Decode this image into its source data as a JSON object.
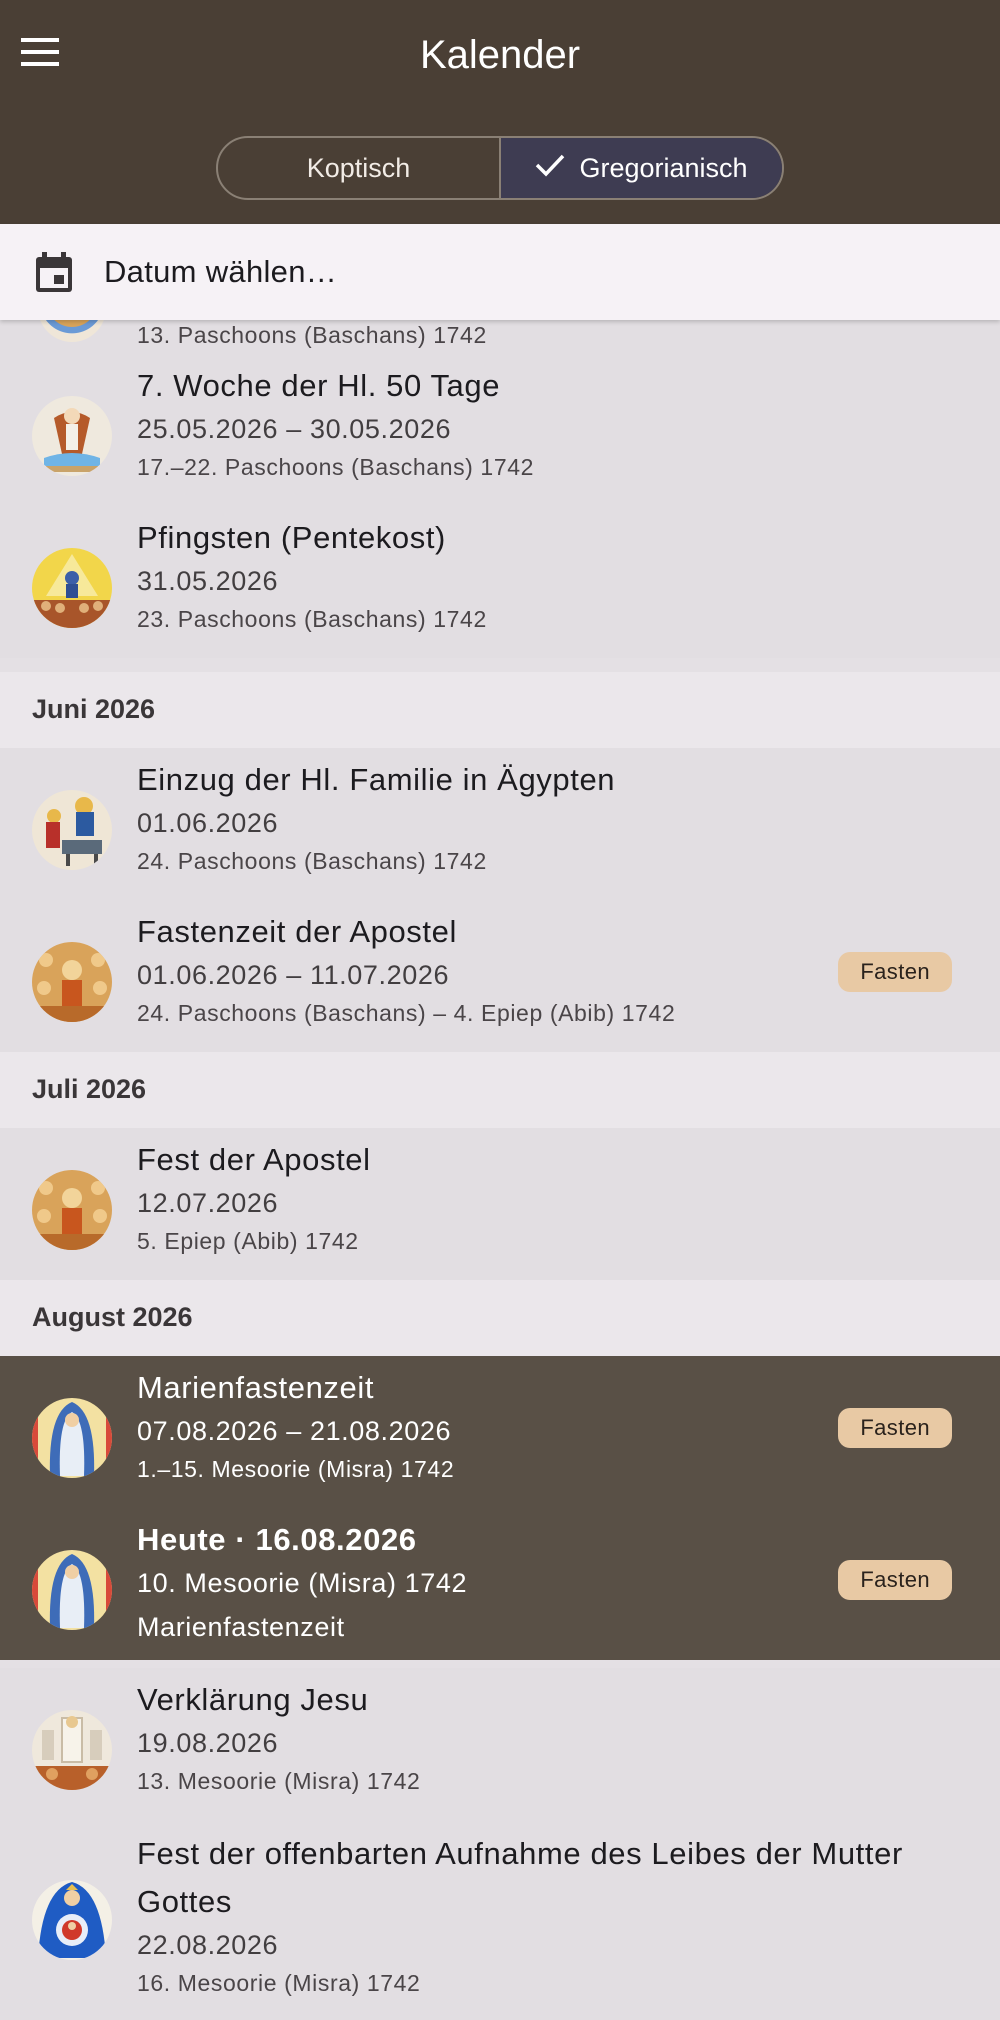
{
  "appbar": {
    "title": "Kalender",
    "segments": [
      {
        "label": "Koptisch",
        "selected": false
      },
      {
        "label": "Gregorianisch",
        "selected": true
      }
    ]
  },
  "datebar": {
    "label": "Datum wählen…"
  },
  "cut_item": {
    "coptic": "13. Paschoons (Baschans) 1742"
  },
  "groups": {
    "may": [
      {
        "title": "7. Woche der Hl. 50 Tage",
        "date": "25.05.2026 – 30.05.2026",
        "coptic": "17.–22. Paschoons (Baschans) 1742",
        "icon": "jesus-ascension-icon"
      },
      {
        "title": "Pfingsten (Pentekost)",
        "date": "31.05.2026",
        "coptic": "23. Paschoons (Baschans) 1742",
        "icon": "pentecost-icon"
      }
    ],
    "june_header": "Juni 2026",
    "june": [
      {
        "title": "Einzug der Hl. Familie in Ägypten",
        "date": "01.06.2026",
        "coptic": "24. Paschoons (Baschans) 1742",
        "icon": "holy-family-icon"
      },
      {
        "title": "Fastenzeit der Apostel",
        "date": "01.06.2026 – 11.07.2026",
        "coptic": "24. Paschoons (Baschans) – 4. Epiep (Abib) 1742",
        "badge": "Fasten",
        "icon": "apostles-icon"
      }
    ],
    "july_header": "Juli 2026",
    "july": [
      {
        "title": "Fest der Apostel",
        "date": "12.07.2026",
        "coptic": "5. Epiep (Abib) 1742",
        "icon": "apostles-icon"
      }
    ],
    "august_header": "August 2026",
    "august_dark": [
      {
        "title": "Marienfastenzeit",
        "date": "07.08.2026 – 21.08.2026",
        "coptic": "1.–15. Mesoorie (Misra) 1742",
        "badge": "Fasten",
        "icon": "virgin-mary-icon"
      },
      {
        "title": "Heute · 16.08.2026",
        "date": "10. Mesoorie (Misra) 1742",
        "coptic": "Marienfastenzeit",
        "badge": "Fasten",
        "icon": "virgin-mary-icon"
      }
    ],
    "august": [
      {
        "title": "Verklärung Jesu",
        "date": "19.08.2026",
        "coptic": "13. Mesoorie (Misra) 1742",
        "icon": "transfiguration-icon"
      },
      {
        "title": "Fest der offenbarten Aufnahme des Leibes der Mutter Gottes",
        "date": "22.08.2026",
        "coptic": "16. Mesoorie (Misra) 1742",
        "icon": "mother-of-god-icon"
      }
    ]
  },
  "colors": {
    "appbar": "#4a3f35",
    "selected_segment": "#3e3c52",
    "list_background": "#e2dee2",
    "today_background": "#595046",
    "badge": "#e8c9a4"
  }
}
